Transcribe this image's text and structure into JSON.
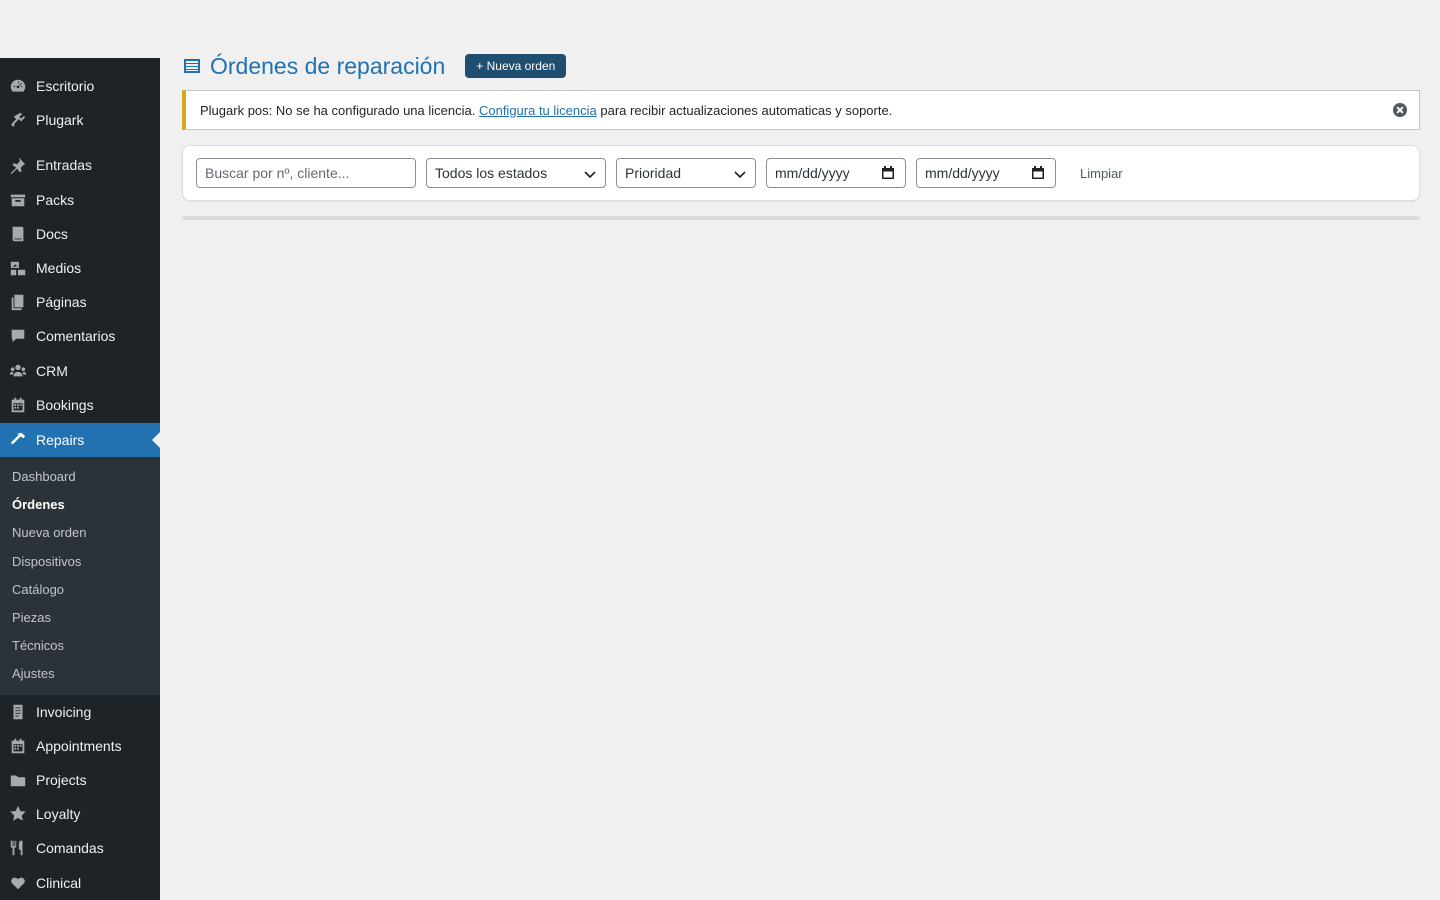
{
  "sidebar": {
    "items": [
      {
        "label": "Escritorio",
        "icon": "dashboard-icon"
      },
      {
        "label": "Plugark",
        "icon": "plugin-icon"
      },
      {
        "label": "Entradas",
        "icon": "pin-icon"
      },
      {
        "label": "Packs",
        "icon": "archive-icon"
      },
      {
        "label": "Docs",
        "icon": "book-icon"
      },
      {
        "label": "Medios",
        "icon": "media-icon"
      },
      {
        "label": "Páginas",
        "icon": "pages-icon"
      },
      {
        "label": "Comentarios",
        "icon": "comment-icon"
      },
      {
        "label": "CRM",
        "icon": "groups-icon"
      },
      {
        "label": "Bookings",
        "icon": "calendar-icon"
      },
      {
        "label": "Repairs",
        "icon": "hammer-icon",
        "active": true
      },
      {
        "label": "Invoicing",
        "icon": "invoice-icon"
      },
      {
        "label": "Appointments",
        "icon": "calendar-icon"
      },
      {
        "label": "Projects",
        "icon": "folder-icon"
      },
      {
        "label": "Loyalty",
        "icon": "star-icon"
      },
      {
        "label": "Comandas",
        "icon": "food-icon"
      },
      {
        "label": "Clinical",
        "icon": "heart-icon"
      }
    ],
    "submenu": [
      {
        "label": "Dashboard"
      },
      {
        "label": "Órdenes",
        "current": true
      },
      {
        "label": "Nueva orden"
      },
      {
        "label": "Dispositivos"
      },
      {
        "label": "Catálogo"
      },
      {
        "label": "Piezas"
      },
      {
        "label": "Técnicos"
      },
      {
        "label": "Ajustes"
      }
    ]
  },
  "header": {
    "title": "Órdenes de reparación",
    "new_button": "+ Nueva orden"
  },
  "notice": {
    "prefix": "Plugark pos: No se ha configurado una licencia.",
    "link": "Configura tu licencia",
    "suffix": "para recibir actualizaciones automaticas y soporte."
  },
  "filters": {
    "search_placeholder": "Buscar por nº, cliente...",
    "status_value": "Todos los estados",
    "priority_value": "Prioridad",
    "date_from": "mm/dd/yyyy",
    "date_to": "mm/dd/yyyy",
    "clear_label": "Limpiar"
  },
  "colors": {
    "sidebar_bg": "#1d2327",
    "submenu_bg": "#2c3338",
    "accent": "#2271b1",
    "button_bg": "#1f4e70",
    "notice_border": "#dba617"
  }
}
